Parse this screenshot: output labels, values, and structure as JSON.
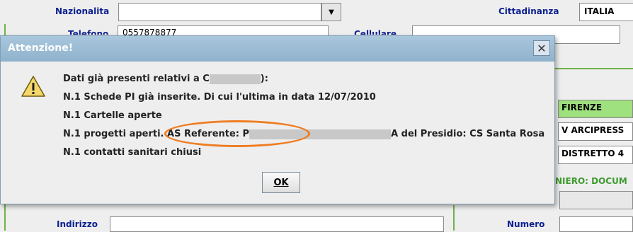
{
  "form": {
    "nazionalita_label": "Nazionalita",
    "cittadinanza_label": "Cittadinanza",
    "cittadinanza_value": "ITALIA",
    "telefono_label": "Telefono",
    "telefono_value": "0557878877",
    "cellulare_label": "Cellulare",
    "indirizzo_label": "Indirizzo",
    "numero_label": "Numero",
    "right_fields": [
      "FIRENZE",
      "V ARCIPRESS",
      "DISTRETTO 4"
    ],
    "right_green_text": "NIERO: DOCUM"
  },
  "dialog": {
    "title": "Attenzione!",
    "close_symbol": "✕",
    "line1_prefix": "Dati già presenti relativi a C",
    "line1_suffix": "):",
    "line2": "N.1 Schede PI già inserite. Di cui l'ultima in data 12/07/2010",
    "line3": "N.1 Cartelle aperte",
    "line4_prefix": "N.1 progetti aperti.",
    "line4_highlight": "AS Referente: P",
    "line4_suffix": "A del Presidio: CS Santa Rosa",
    "line5": "N.1 contatti sanitari chiusi",
    "ok_label": "OK"
  },
  "colors": {
    "highlight_oval": "#ef7d22",
    "label_blue": "#0a1f8f",
    "green_field": "#9fe07f"
  }
}
